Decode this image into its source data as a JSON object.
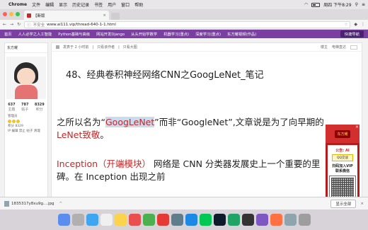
{
  "menubar": {
    "app": "Chrome",
    "items": [
      "文件",
      "编辑",
      "显示",
      "历史记录",
      "书签",
      "用户",
      "窗口",
      "帮助"
    ],
    "clock": "周四 下午8:29"
  },
  "tab": {
    "title": "【新版"
  },
  "address": {
    "info": "不安全",
    "url": "www.ai111.vip/thread-640-1-1.html"
  },
  "sitenav": {
    "items": [
      "首页",
      "人人必学之人工智能",
      "Python基础与高级",
      "网站开发Django",
      "从头开始学数学",
      "机器学习(重点)",
      "深度学习(重点)",
      "东方耀视频(作品)"
    ],
    "quick": "快捷导航"
  },
  "sidebar": {
    "username": "东方耀",
    "stats": [
      {
        "num": "637",
        "lbl": "主题"
      },
      {
        "num": "787",
        "lbl": "帖子"
      },
      {
        "num": "8329",
        "lbl": "积分"
      }
    ],
    "role": "管理员",
    "points_label": "积分",
    "points_value": "8329",
    "actions": "IP 编辑 禁止 帖子 清理"
  },
  "post": {
    "meta_time": "发表于 2 小时前",
    "meta_author_only": "只看该作者",
    "meta_big": "只看大图",
    "meta_prev": "楼主",
    "meta_qr": "电梯直达",
    "title": "48、经典卷积神经网络CNN之GoogLeNet_笔记",
    "para1_a": "之所以名为“",
    "para1_hl": "GoogLeNet",
    "para1_b": "”而非“GoogleNet”,文章说是为了向早期的",
    "para1_c": "LeNet致敬",
    "para1_d": "。",
    "para2_red": "Inception（开端模块）",
    "para2_rest": " 网络是 CNN 分类器发展史上一个重要的里",
    "para3": "碑。在 Inception 出现之前"
  },
  "ad": {
    "badge": "东方耀",
    "publish": "公告: AI",
    "qq_label": "QQ交谈",
    "scan_line1": "扫码加入VIP",
    "scan_line2": "联系微信"
  },
  "download": {
    "filename": "1835317y8xu9g....jpg",
    "show_all": "显示全部"
  }
}
